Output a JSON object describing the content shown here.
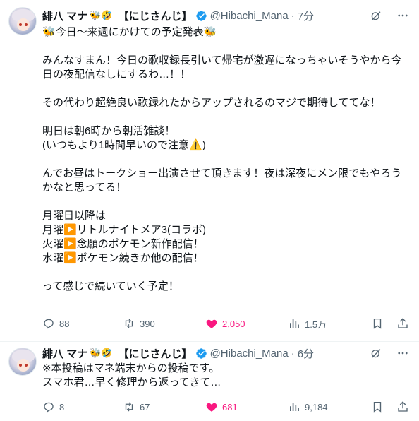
{
  "tweets": [
    {
      "author_name": "緋八 マナ",
      "name_emoji": "🐝🤣",
      "affiliation": "【にじさんじ】",
      "handle": "@Hibachi_Mana",
      "separator": "·",
      "time": "7分",
      "text": "🐝今日〜来週にかけての予定発表🐝\n\nみんなすまん！今日の歌収録長引いて帰宅が激遅になっちゃいそうやから今日の夜配信なしにするわ…！！\n\nその代わり超絶良い歌録れたからアップされるのマジで期待しててな！\n\n明日は朝6時から朝活雑談！\n(いつもより1時間早いので注意⚠️)\n\nんでお昼はトークショー出演させて頂きます！夜は深夜にメン限でもやろうかなと思ってる！\n\n月曜日以降は\n月曜▶️リトルナイトメア3(コラボ)\n火曜▶️念願のポケモン新作配信！\n水曜▶️ポケモン続きか他の配信！\n\nって感じで続いていく予定！",
      "replies": "88",
      "reposts": "390",
      "likes": "2,050",
      "views": "1.5万"
    },
    {
      "author_name": "緋八 マナ",
      "name_emoji": "🐝🤣",
      "affiliation": "【にじさんじ】",
      "handle": "@Hibachi_Mana",
      "separator": "·",
      "time": "6分",
      "text": "※本投稿はマネ端末からの投稿です。\nスマホ君…早く修理から返ってきて…",
      "replies": "8",
      "reposts": "67",
      "likes": "681",
      "views": "9,184"
    }
  ],
  "colors": {
    "text": "#0f1419",
    "secondary": "#536471",
    "verified": "#1d9bf0",
    "like": "#f91880",
    "border": "#eff3f4"
  },
  "icons": [
    "verified-badge-icon",
    "grok-icon",
    "more-icon",
    "reply-icon",
    "repost-icon",
    "like-icon",
    "views-icon",
    "bookmark-icon",
    "share-icon"
  ]
}
